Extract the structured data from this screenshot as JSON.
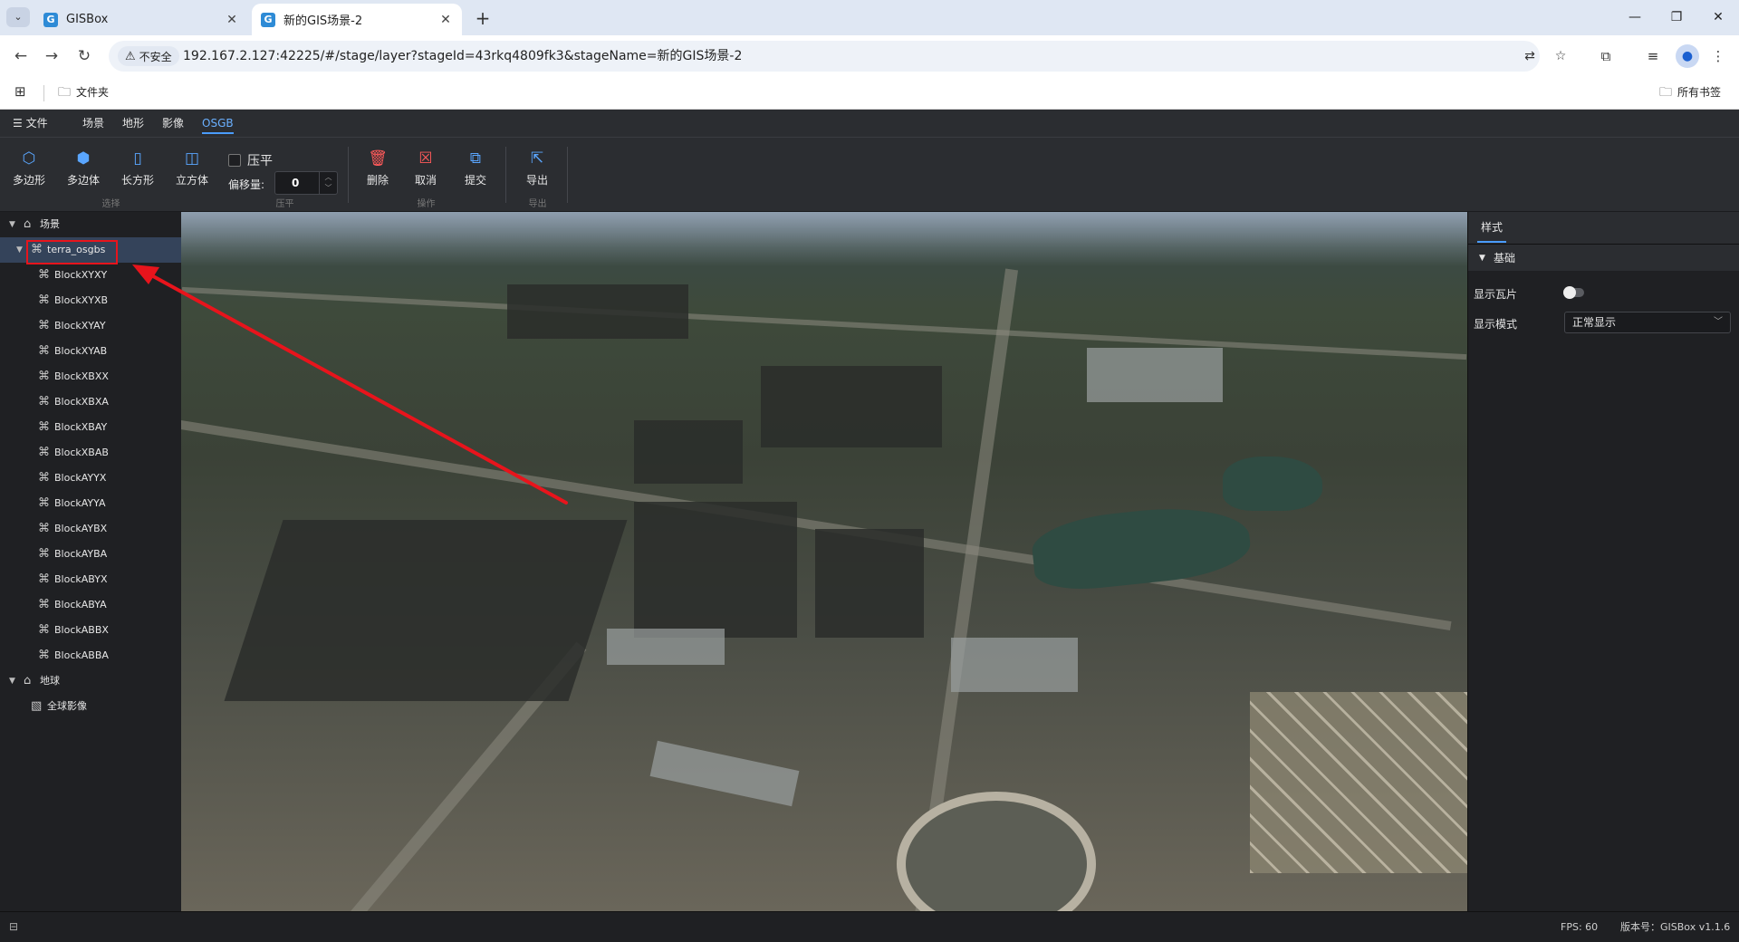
{
  "browser": {
    "tabs": [
      {
        "title": "GISBox",
        "favicon": "G",
        "active": false
      },
      {
        "title": "新的GIS场景-2",
        "favicon": "G",
        "active": true
      }
    ],
    "security_label": "不安全",
    "url": "192.167.2.127:42225/#/stage/layer?stageId=43rkq4809fk3&stageName=新的GIS场景-2",
    "bookmarks": {
      "folder": "文件夹",
      "all_bookmarks": "所有书签"
    }
  },
  "menubar": {
    "file": "文件",
    "items": [
      "场景",
      "地形",
      "影像",
      "OSGB"
    ],
    "active_index": 3
  },
  "toolbar": {
    "select_group": {
      "label": "选择",
      "tools": [
        {
          "label": "多边形",
          "icon": "polygon-icon"
        },
        {
          "label": "多边体",
          "icon": "polyhedron-icon"
        },
        {
          "label": "长方形",
          "icon": "rectangle-icon"
        },
        {
          "label": "立方体",
          "icon": "cube-icon"
        }
      ]
    },
    "press_group": {
      "label": "压平",
      "checkbox_label": "压平",
      "offset_label": "偏移量:",
      "offset_value": "0"
    },
    "op_group": {
      "label": "操作",
      "tools": [
        {
          "label": "删除",
          "icon": "trash-icon"
        },
        {
          "label": "取消",
          "icon": "cancel-icon"
        },
        {
          "label": "提交",
          "icon": "submit-icon"
        }
      ]
    },
    "export_group": {
      "label": "导出",
      "tools": [
        {
          "label": "导出",
          "icon": "export-icon"
        }
      ]
    }
  },
  "tree": {
    "scene": {
      "label": "场景",
      "layer": {
        "label": "terra_osgbs",
        "children": [
          "BlockXYXY",
          "BlockXYXB",
          "BlockXYAY",
          "BlockXYAB",
          "BlockXBXX",
          "BlockXBXA",
          "BlockXBAY",
          "BlockXBAB",
          "BlockAYYX",
          "BlockAYYA",
          "BlockAYBX",
          "BlockAYBA",
          "BlockABYX",
          "BlockABYA",
          "BlockABBX",
          "BlockABBA"
        ]
      }
    },
    "earth": {
      "label": "地球",
      "children": [
        "全球影像"
      ]
    }
  },
  "rightpanel": {
    "tab": "样式",
    "section": "基础",
    "show_tiles_label": "显示瓦片",
    "show_tiles": false,
    "display_mode_label": "显示模式",
    "display_mode_value": "正常显示"
  },
  "statusbar": {
    "fps": "FPS: 60",
    "version": "版本号：GISBox v1.1.6"
  },
  "colors": {
    "accent": "#4a9cff",
    "annotation": "#e8141c",
    "selected_row": "#34435a"
  }
}
